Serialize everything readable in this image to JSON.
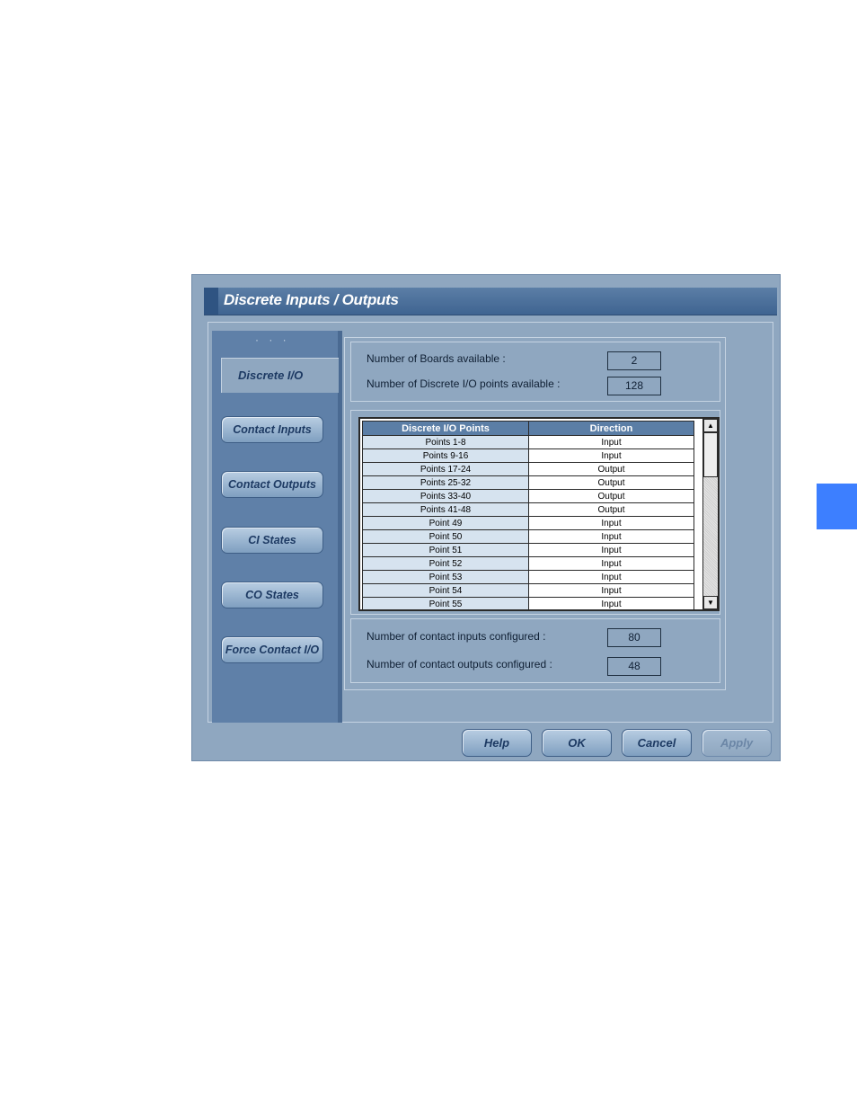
{
  "window": {
    "title": "Discrete Inputs / Outputs"
  },
  "sidebar": {
    "selected": "Discrete I/O",
    "items": [
      {
        "label": "Contact Inputs"
      },
      {
        "label": "Contact Outputs"
      },
      {
        "label": "CI States"
      },
      {
        "label": "CO States"
      },
      {
        "label": "Force Contact I/O"
      }
    ]
  },
  "boards": {
    "boards_label": "Number of Boards available :",
    "boards_value": "2",
    "points_label": "Number of Discrete I/O points available :",
    "points_value": "128"
  },
  "grid": {
    "headers": [
      "Discrete I/O Points",
      "Direction"
    ],
    "rows": [
      [
        "Points 1-8",
        "Input"
      ],
      [
        "Points 9-16",
        "Input"
      ],
      [
        "Points 17-24",
        "Output"
      ],
      [
        "Points 25-32",
        "Output"
      ],
      [
        "Points 33-40",
        "Output"
      ],
      [
        "Points 41-48",
        "Output"
      ],
      [
        "Point 49",
        "Input"
      ],
      [
        "Point 50",
        "Input"
      ],
      [
        "Point 51",
        "Input"
      ],
      [
        "Point 52",
        "Input"
      ],
      [
        "Point 53",
        "Input"
      ],
      [
        "Point 54",
        "Input"
      ],
      [
        "Point 55",
        "Input"
      ]
    ]
  },
  "configured": {
    "inputs_label": "Number of contact inputs configured :",
    "inputs_value": "80",
    "outputs_label": "Number of contact outputs configured :",
    "outputs_value": "48"
  },
  "buttons": {
    "help": "Help",
    "ok": "OK",
    "cancel": "Cancel",
    "apply": "Apply"
  },
  "colors": {
    "accent_tab": "#3d7fff",
    "window_bg": "#8fa7c0",
    "titlebar": "#3f6491"
  },
  "icons": {
    "scroll_up": "▲",
    "scroll_down": "▼"
  }
}
